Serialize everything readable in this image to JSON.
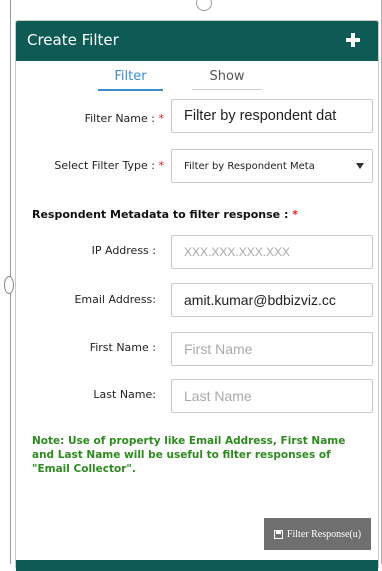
{
  "panel": {
    "title": "Create Filter",
    "add_icon": "plus-icon"
  },
  "tabs": [
    {
      "label": "Filter",
      "active": true
    },
    {
      "label": "Show",
      "active": false
    }
  ],
  "filter_name": {
    "label": "Filter Name :",
    "required_mark": "*",
    "value": "Filter by respondent dat"
  },
  "filter_type": {
    "label": "Select Filter Type :",
    "required_mark": "*",
    "selected": "Filter by Respondent Meta"
  },
  "metadata_section": {
    "heading": "Respondent Metadata to filter response :",
    "required_mark": "*"
  },
  "fields": {
    "ip": {
      "label": "IP Address :",
      "placeholder": "XXX.XXX.XXX.XXX"
    },
    "email": {
      "label": "Email Address:",
      "value": "amit.kumar@bdbizviz.cc"
    },
    "first_name": {
      "label": "First Name :",
      "placeholder": "First Name"
    },
    "last_name": {
      "label": "Last Name:",
      "placeholder": "Last Name"
    }
  },
  "note": "Note: Use of property like Email Address, First Name and Last Name will be useful to filter responses of \"Email Collector\".",
  "submit_button": {
    "label": "Filter Response(u)",
    "icon": "floppy-disk-icon"
  },
  "colors": {
    "header": "#0e5b56",
    "accent": "#3a8dd1",
    "required": "#e02020",
    "note": "#2e8b1f",
    "button": "#6f6f6f"
  }
}
